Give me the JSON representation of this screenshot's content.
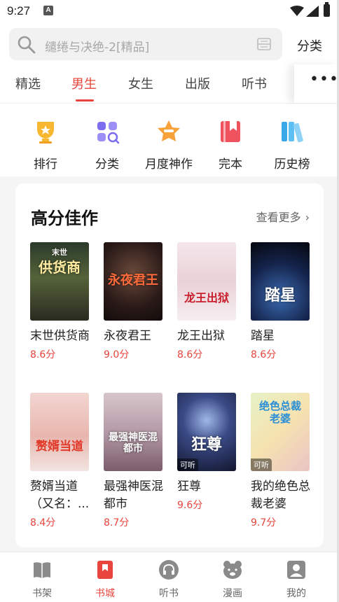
{
  "status": {
    "time": "9:27",
    "notif_glyph": "A"
  },
  "search": {
    "placeholder": "缱绻与决绝-2[精品]",
    "category_label": "分类"
  },
  "tabs": [
    {
      "label": "精选"
    },
    {
      "label": "男生"
    },
    {
      "label": "女生"
    },
    {
      "label": "出版"
    },
    {
      "label": "听书"
    }
  ],
  "tabs_more": "•••",
  "quick_links": [
    {
      "label": "排行",
      "icon": "trophy-icon"
    },
    {
      "label": "分类",
      "icon": "category-grid-icon"
    },
    {
      "label": "月度神作",
      "icon": "star-badge-icon"
    },
    {
      "label": "完本",
      "icon": "bookmark-book-icon"
    },
    {
      "label": "历史榜",
      "icon": "bookshelf-icon"
    }
  ],
  "section": {
    "title": "高分佳作",
    "more_label": "查看更多",
    "books": [
      {
        "name": "末世供货商",
        "score": "8.6分",
        "cover_text": "供货商",
        "cover_top": "末世",
        "listen": ""
      },
      {
        "name": "永夜君王",
        "score": "9.0分",
        "cover_text": "永夜君王",
        "cover_top": "",
        "listen": ""
      },
      {
        "name": "龙王出狱",
        "score": "8.6分",
        "cover_text": "龙王出狱",
        "cover_top": "",
        "listen": ""
      },
      {
        "name": "踏星",
        "score": "8.6分",
        "cover_text": "踏星",
        "cover_top": "",
        "listen": ""
      },
      {
        "name": "赘婿当道（又名：...",
        "score": "8.4分",
        "cover_text": "赘婿当道",
        "cover_top": "",
        "listen": ""
      },
      {
        "name": "最强神医混都市",
        "score": "8.7分",
        "cover_text": "最强神医混都市",
        "cover_top": "",
        "listen": ""
      },
      {
        "name": "狂尊",
        "score": "9.6分",
        "cover_text": "狂尊",
        "cover_top": "",
        "listen": "可听"
      },
      {
        "name": "我的绝色总裁老婆",
        "score": "9.7分",
        "cover_text": "绝色总裁老婆",
        "cover_top": "",
        "listen": "可听"
      }
    ]
  },
  "bottom_nav": [
    {
      "label": "书架",
      "icon": "bookshelf-nav-icon"
    },
    {
      "label": "书城",
      "icon": "bookstore-nav-icon"
    },
    {
      "label": "听书",
      "icon": "headphones-icon"
    },
    {
      "label": "漫画",
      "icon": "bear-icon"
    },
    {
      "label": "我的",
      "icon": "profile-icon"
    }
  ],
  "colors": {
    "accent": "#e8453c",
    "text": "#222222",
    "muted": "#666666"
  }
}
